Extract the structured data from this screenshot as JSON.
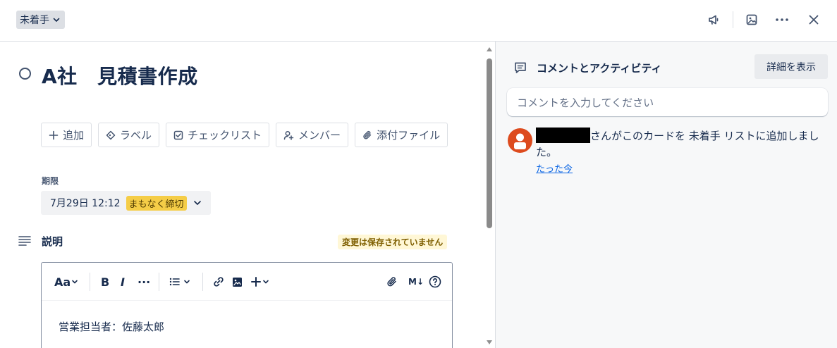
{
  "header": {
    "status_label": "未着手",
    "icons": [
      "megaphone-icon",
      "image-icon",
      "more-icon",
      "close-icon"
    ]
  },
  "card": {
    "title": "A社　見積書作成"
  },
  "actions": [
    {
      "name": "add",
      "icon": "plus-icon",
      "label": "追加"
    },
    {
      "name": "labels",
      "icon": "tag-icon",
      "label": "ラベル"
    },
    {
      "name": "checklist",
      "icon": "checkbox-icon",
      "label": "チェックリスト"
    },
    {
      "name": "members",
      "icon": "add-user-icon",
      "label": "メンバー"
    },
    {
      "name": "attachment",
      "icon": "paperclip-icon",
      "label": "添付ファイル"
    }
  ],
  "due": {
    "label": "期限",
    "date": "7月29日 12:12",
    "badge": "まもなく締切",
    "badge_color": "#f5cd47"
  },
  "description": {
    "label": "説明",
    "unsaved_notice": "変更は保存されていません",
    "toolbar": {
      "text_style": "Aa",
      "bold": "B",
      "italic": "I",
      "more": "···",
      "markdown": "M↓"
    },
    "content": "営業担当者：佐藤太郎"
  },
  "sidebar": {
    "title": "コメントとアクティビティ",
    "details_button": "詳細を表示",
    "comment_placeholder": "コメントを入力してください",
    "activity": {
      "text": "さんがこのカードを 未着手 リストに追加しました。",
      "time": "たった今",
      "avatar_color": "#dd4b1e"
    }
  }
}
